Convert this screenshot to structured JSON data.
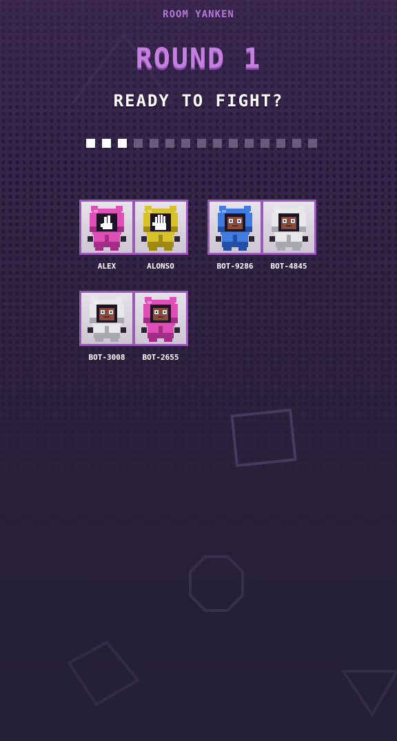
{
  "room": {
    "name": "ROOM YANKEN"
  },
  "round": {
    "title": "ROUND 1",
    "prompt": "READY TO FIGHT?"
  },
  "progress": {
    "total_segments": 15,
    "filled_segments": 3,
    "filled_color": "#ffffff",
    "empty_color": "#6a5a7c"
  },
  "teams": [
    {
      "players": [
        {
          "name": "ALEX",
          "color": "#e04fb8",
          "shade": "#a22c86",
          "face": "hand-peace-icon"
        },
        {
          "name": "ALONSO",
          "color": "#d8c22a",
          "shade": "#9e8a12",
          "face": "hand-palm-icon"
        }
      ]
    },
    {
      "players": [
        {
          "name": "BOT-9286",
          "color": "#3f7be0",
          "shade": "#244fa6",
          "face": "bot-face-icon"
        },
        {
          "name": "BOT-4845",
          "color": "#e8e8ea",
          "shade": "#a8a8b0",
          "face": "bot-face-icon"
        }
      ]
    },
    {
      "players": [
        {
          "name": "BOT-3008",
          "color": "#e8e8ea",
          "shade": "#a8a8b0",
          "face": "bot-face-icon"
        },
        {
          "name": "BOT-2655",
          "color": "#e04fb8",
          "shade": "#a22c86",
          "face": "bot-face-icon"
        }
      ]
    }
  ],
  "colors": {
    "accent": "#c57fe0",
    "frame": "#9a59b4",
    "background_top": "#3b2750",
    "background_bottom": "#232035"
  }
}
